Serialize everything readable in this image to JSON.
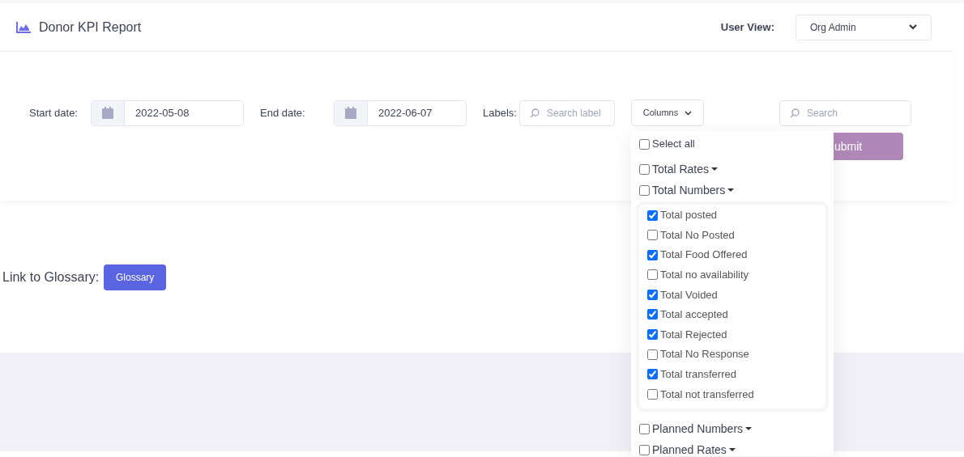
{
  "header": {
    "title": "Donor KPI Report",
    "user_view_label": "User View:",
    "user_view_value": "Org Admin"
  },
  "filters": {
    "start_label": "Start date:",
    "start_value": "2022-05-08",
    "end_label": "End date:",
    "end_value": "2022-06-07",
    "labels_label": "Labels:",
    "labels_placeholder": "Search label",
    "columns_button": "Columns",
    "search_placeholder": "Search",
    "submit_button": "ubmit"
  },
  "columns_menu": {
    "select_all": {
      "label": "Select all",
      "checked": false
    },
    "groups": [
      {
        "label": "Total Rates",
        "checked": false
      },
      {
        "label": "Total Numbers",
        "checked": false,
        "children": [
          {
            "label": "Total posted",
            "checked": true
          },
          {
            "label": "Total No Posted",
            "checked": false
          },
          {
            "label": "Total Food Offered",
            "checked": true
          },
          {
            "label": "Total no availability",
            "checked": false
          },
          {
            "label": "Total Voided",
            "checked": true
          },
          {
            "label": "Total accepted",
            "checked": true
          },
          {
            "label": "Total Rejected",
            "checked": true
          },
          {
            "label": "Total No Response",
            "checked": false
          },
          {
            "label": "Total transferred",
            "checked": true
          },
          {
            "label": "Total not transferred",
            "checked": false
          }
        ]
      },
      {
        "label": "Planned Numbers",
        "checked": false
      },
      {
        "label": "Planned Rates",
        "checked": false
      }
    ]
  },
  "glossary": {
    "label": "Link to Glossary:",
    "button": "Glossary"
  }
}
